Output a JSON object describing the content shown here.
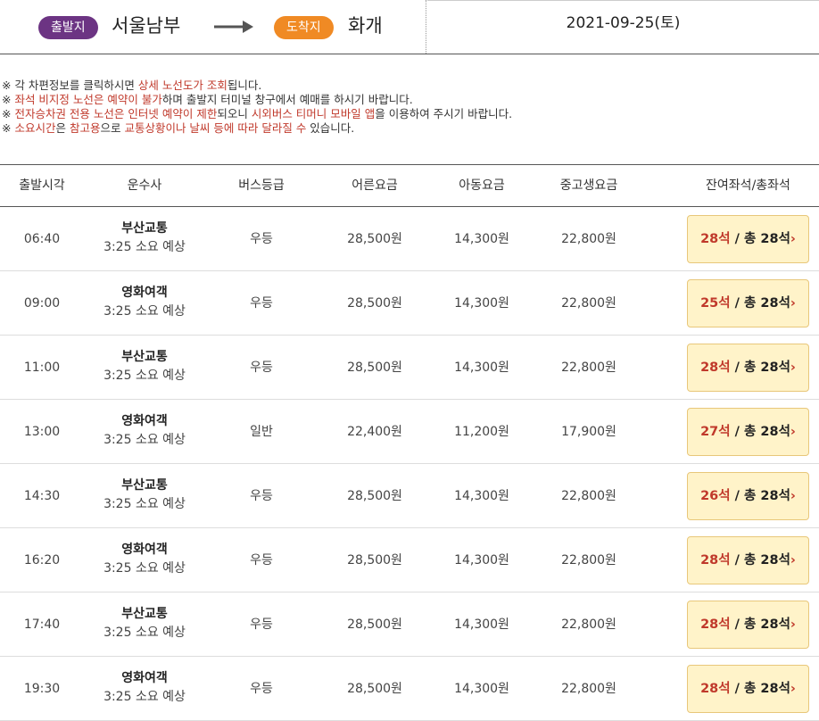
{
  "route": {
    "departure_badge": "출발지",
    "departure_terminal": "서울남부",
    "arrival_badge": "도착지",
    "arrival_terminal": "화개",
    "date": "2021-09-25(토)"
  },
  "colors": {
    "departure_badge": "#6c3483",
    "arrival_badge": "#f08a24",
    "highlight": "#c0392b",
    "seat_button_bg": "#fff3c9"
  },
  "notices": [
    {
      "parts": [
        {
          "t": "※ 각 차편정보를 클릭하시면 ",
          "h": false
        },
        {
          "t": "상세 노선도가 조회",
          "h": true
        },
        {
          "t": "됩니다.",
          "h": false
        }
      ]
    },
    {
      "parts": [
        {
          "t": "※ ",
          "h": false
        },
        {
          "t": "좌석 비지정 노선은 예약이 불가",
          "h": true
        },
        {
          "t": "하며 출발지 터미널 창구에서 예매를 하시기 바랍니다.",
          "h": false
        }
      ]
    },
    {
      "parts": [
        {
          "t": "※ ",
          "h": false
        },
        {
          "t": "전자승차권 전용 노선은 인터넷 예약이 제한",
          "h": true
        },
        {
          "t": "되오니 ",
          "h": false
        },
        {
          "t": "시외버스 티머니 모바일 앱",
          "h": true
        },
        {
          "t": "을 이용하여 주시기 바랍니다.",
          "h": false
        }
      ]
    },
    {
      "parts": [
        {
          "t": "※ ",
          "h": false
        },
        {
          "t": "소요시간",
          "h": true
        },
        {
          "t": "은 ",
          "h": false
        },
        {
          "t": "참고용",
          "h": true
        },
        {
          "t": "으로 ",
          "h": false
        },
        {
          "t": "교통상황이나 날씨 등에 따라 달라질 수",
          "h": true
        },
        {
          "t": " 있습니다.",
          "h": false
        }
      ]
    }
  ],
  "table": {
    "headers": {
      "time": "출발시각",
      "company": "운수사",
      "grade": "버스등급",
      "adult": "어른요금",
      "child": "아동요금",
      "student": "중고생요금",
      "seats": "잔여좌석/총좌석"
    },
    "rows": [
      {
        "time": "06:40",
        "company": "부산교통",
        "duration": "3:25 소요 예상",
        "grade": "우등",
        "adult": "28,500원",
        "child": "14,300원",
        "student": "22,800원",
        "remain": "28석",
        "total": " / 총 28석"
      },
      {
        "time": "09:00",
        "company": "영화여객",
        "duration": "3:25 소요 예상",
        "grade": "우등",
        "adult": "28,500원",
        "child": "14,300원",
        "student": "22,800원",
        "remain": "25석",
        "total": " / 총 28석"
      },
      {
        "time": "11:00",
        "company": "부산교통",
        "duration": "3:25 소요 예상",
        "grade": "우등",
        "adult": "28,500원",
        "child": "14,300원",
        "student": "22,800원",
        "remain": "28석",
        "total": " / 총 28석"
      },
      {
        "time": "13:00",
        "company": "영화여객",
        "duration": "3:25 소요 예상",
        "grade": "일반",
        "adult": "22,400원",
        "child": "11,200원",
        "student": "17,900원",
        "remain": "27석",
        "total": " / 총 28석"
      },
      {
        "time": "14:30",
        "company": "부산교통",
        "duration": "3:25 소요 예상",
        "grade": "우등",
        "adult": "28,500원",
        "child": "14,300원",
        "student": "22,800원",
        "remain": "26석",
        "total": " / 총 28석"
      },
      {
        "time": "16:20",
        "company": "영화여객",
        "duration": "3:25 소요 예상",
        "grade": "우등",
        "adult": "28,500원",
        "child": "14,300원",
        "student": "22,800원",
        "remain": "28석",
        "total": " / 총 28석"
      },
      {
        "time": "17:40",
        "company": "부산교통",
        "duration": "3:25 소요 예상",
        "grade": "우등",
        "adult": "28,500원",
        "child": "14,300원",
        "student": "22,800원",
        "remain": "28석",
        "total": " / 총 28석"
      },
      {
        "time": "19:30",
        "company": "영화여객",
        "duration": "3:25 소요 예상",
        "grade": "우등",
        "adult": "28,500원",
        "child": "14,300원",
        "student": "22,800원",
        "remain": "28석",
        "total": " / 총 28석"
      }
    ]
  }
}
